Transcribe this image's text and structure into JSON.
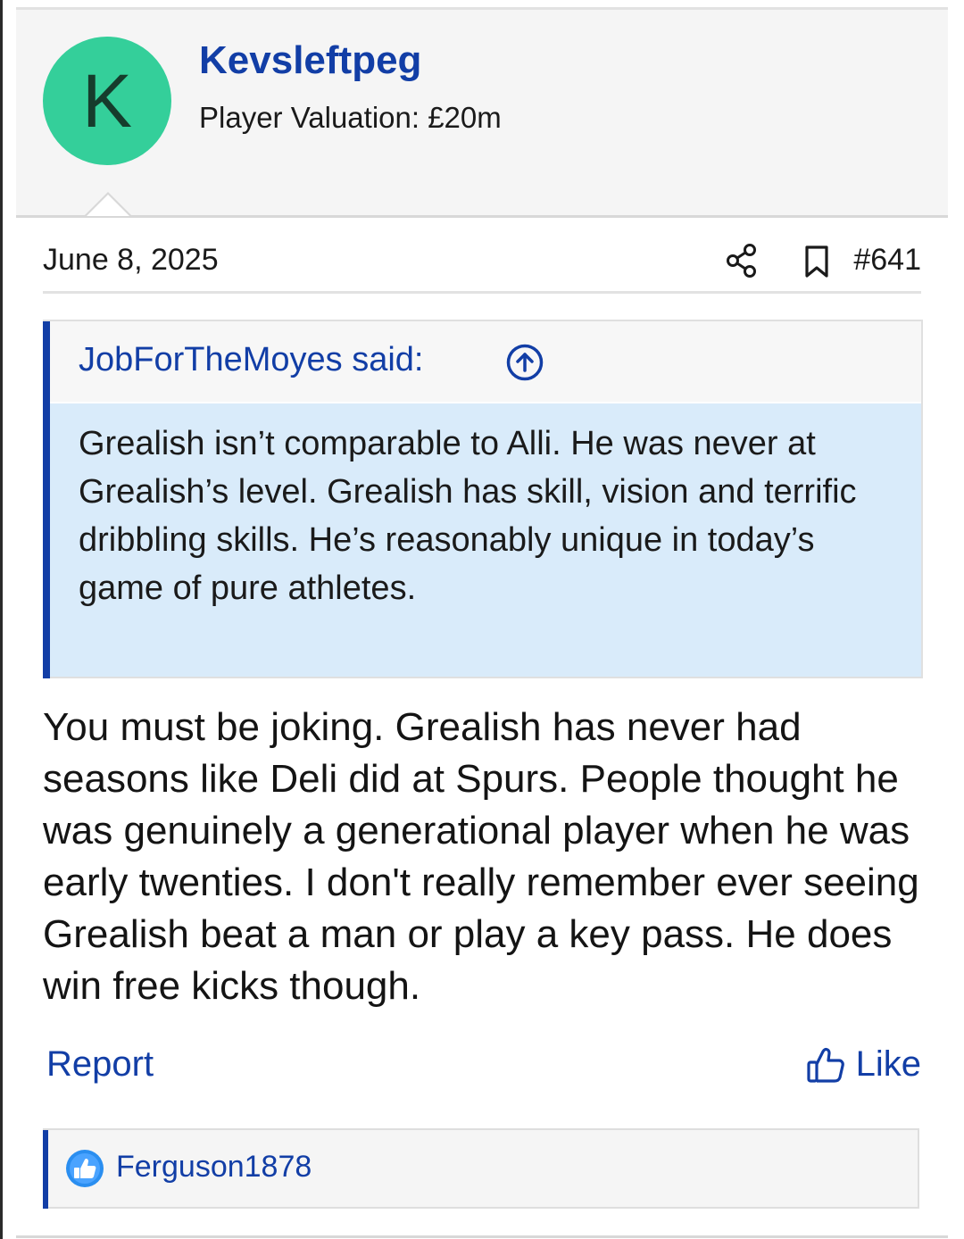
{
  "author": {
    "avatar_letter": "K",
    "avatar_color": "#34cf9a",
    "name": "Kevsleftpeg",
    "title": "Player Valuation: £20m"
  },
  "meta": {
    "date": "June 8, 2025",
    "share_icon": "share-icon",
    "bookmark_icon": "bookmark-icon",
    "post_number": "#641"
  },
  "quote": {
    "author_label": "JobForTheMoyes said:",
    "jump_icon": "arrow-up-circle-icon",
    "text": "Grealish isn’t comparable to Alli. He was never at Grealish’s level. Grealish has skill, vision and terrific dribbling skills. He’s reasonably unique in today’s game of pure athletes."
  },
  "message": {
    "text": "You must be joking. Grealish has never had seasons like Deli did at Spurs. People thought he was genuinely a generational player when he was early twenties. I don't really remember ever seeing Grealish beat a man or play a key pass. He does win free kicks though."
  },
  "actions": {
    "report_label": "Report",
    "like_label": "Like",
    "like_icon": "thumbs-up-icon"
  },
  "reactions": {
    "icon": "like-reaction-icon",
    "users": "Ferguson1878"
  },
  "colors": {
    "accent": "#123ea6",
    "quote_bg": "#d9ebfa",
    "header_bg": "#f5f5f5"
  }
}
